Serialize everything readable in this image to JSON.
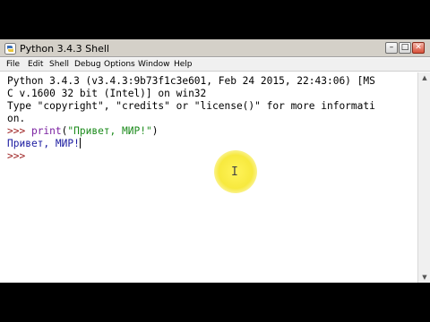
{
  "window": {
    "title": "Python 3.4.3 Shell",
    "controls": {
      "minimize": "–",
      "maximize": "□",
      "close": "✕"
    }
  },
  "menubar": {
    "items": [
      "File",
      "Edit",
      "Shell",
      "Debug",
      "Options",
      "Window",
      "Help"
    ]
  },
  "shell": {
    "banner": [
      "Python 3.4.3 (v3.4.3:9b73f1c3e601, Feb 24 2015, 22:43:06) [MS",
      "C v.1600 32 bit (Intel)] on win32",
      "Type \"copyright\", \"credits\" or \"license()\" for more informati",
      "on."
    ],
    "prompt": ">>> ",
    "input_func": "print",
    "input_open": "(",
    "input_string": "\"Привет, МИР!\"",
    "input_close": ")",
    "output": "Привет, МИР!",
    "next_prompt": ">>>"
  },
  "colors": {
    "prompt": "#9b1d1d",
    "builtin": "#7a1fa0",
    "string": "#1a8a1a",
    "output": "#1a1aa0",
    "cursor_highlight": "#f7e93e"
  },
  "icons": {
    "app": "python-idle-icon",
    "scroll_up": "scroll-up-arrow",
    "scroll_down": "scroll-down-arrow",
    "pointer": "text-ibeam-cursor"
  }
}
